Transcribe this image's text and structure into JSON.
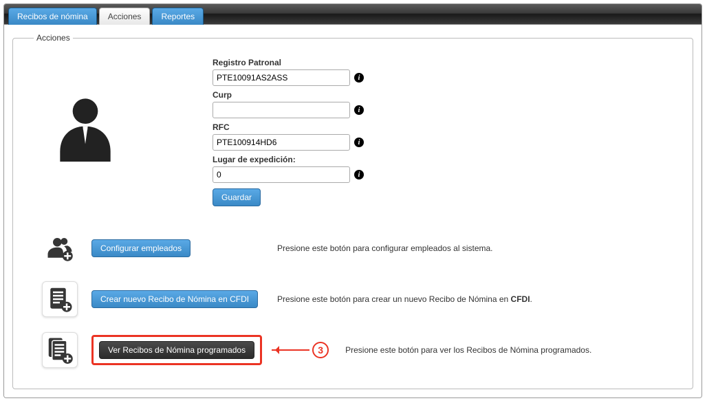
{
  "tabs": {
    "recibos": "Recibos de nómina",
    "acciones": "Acciones",
    "reportes": "Reportes"
  },
  "legend": "Acciones",
  "form": {
    "registro_label": "Registro Patronal",
    "registro_value": "PTE10091AS2ASS",
    "curp_label": "Curp",
    "curp_value": "",
    "rfc_label": "RFC",
    "rfc_value": "PTE100914HD6",
    "lugar_label": "Lugar de expedición:",
    "lugar_value": "0",
    "guardar": "Guardar"
  },
  "actions": {
    "config_emp_btn": "Configurar empleados",
    "config_emp_desc": "Presione este botón para configurar empleados al sistema.",
    "crear_btn": "Crear nuevo Recibo de Nómina en CFDI",
    "crear_desc_pre": "Presione este botón para crear un nuevo Recibo de Nómina en ",
    "crear_desc_bold": "CFDI",
    "crear_desc_post": ".",
    "ver_btn": "Ver Recibos de Nómina programados",
    "ver_desc": "Presione este botón para ver los Recibos de Nómina programados."
  },
  "annotation": {
    "num": "3"
  }
}
